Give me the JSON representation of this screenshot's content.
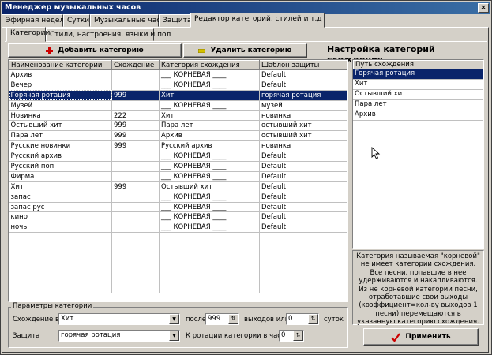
{
  "window": {
    "title": "Менеджер музыкальных часов",
    "close": "×"
  },
  "tabs": [
    {
      "label": "Эфирная неделя"
    },
    {
      "label": "Сутки"
    },
    {
      "label": "Музыкальные часы"
    },
    {
      "label": "Защита"
    },
    {
      "label": "Редактор категорий, стилей и т.д"
    }
  ],
  "subtabs": [
    {
      "label": "Категории"
    },
    {
      "label": "Стили, настроения, языки и пол"
    }
  ],
  "toolbar": {
    "add_label": "Добавить категорию",
    "delete_label": "Удалить категорию"
  },
  "heading": "Настройка категорий схождения",
  "grid": {
    "columns": [
      "Наименование категории",
      "Схождение",
      "Категория схождения",
      "Шаблон защиты"
    ],
    "rows": [
      [
        "Архив",
        "",
        "___ КОРНЕВАЯ ____",
        "Default"
      ],
      [
        "Вечер",
        "",
        "___ КОРНЕВАЯ ____",
        "Default"
      ],
      [
        "Горячая ротация",
        "999",
        "Хит",
        "горячая ротация"
      ],
      [
        "Музей",
        "",
        "___ КОРНЕВАЯ ____",
        "музей"
      ],
      [
        "Новинка",
        "222",
        "Хит",
        "новинка"
      ],
      [
        "Остывший хит",
        "999",
        "Пара лет",
        "остывший хит"
      ],
      [
        "Пара лет",
        "999",
        "Архив",
        "остывший хит"
      ],
      [
        "Русские новинки",
        "999",
        "Русский архив",
        "новинка"
      ],
      [
        "Русский архив",
        "",
        "___ КОРНЕВАЯ ____",
        "Default"
      ],
      [
        "Русский поп",
        "",
        "___ КОРНЕВАЯ ____",
        "Default"
      ],
      [
        "Фирма",
        "",
        "___ КОРНЕВАЯ ____",
        "Default"
      ],
      [
        "Хит",
        "999",
        "Остывший хит",
        "Default"
      ],
      [
        "запас",
        "",
        "___ КОРНЕВАЯ ____",
        "Default"
      ],
      [
        "запас рус",
        "",
        "___ КОРНЕВАЯ ____",
        "Default"
      ],
      [
        "кино",
        "",
        "___ КОРНЕВАЯ ____",
        "Default"
      ],
      [
        "ночь",
        "",
        "___ КОРНЕВАЯ ____",
        "Default"
      ]
    ],
    "selected_row": 2
  },
  "path": {
    "header": "Путь схождения",
    "items": [
      "Горячая ротация",
      "Хит",
      "Остывший хит",
      "Пара лет",
      "Архив"
    ],
    "selected": 0
  },
  "info_text": "Категория называемая \"корневой\" не имеет категории схождения. Все песни, попавшие в нее удерживаются и накапливаются. Из не корневой категории песни, отработавшие свои выходы (коэффициент=кол-ву выходов 1 песни) перемещаются в указанную категорию схождения.",
  "params": {
    "group_label": "Параметры категории",
    "convergence_label": "Схождение в",
    "convergence_value": "Хит",
    "after_label": "после",
    "after_value": "999",
    "outputs_label": "выходов или",
    "days_value": "0",
    "days_label": "суток",
    "protection_label": "Защита",
    "protection_value": "горячая ротация",
    "rotation_label": "К ротации категории в часах",
    "rotation_value": "0"
  },
  "apply_label": "Применить",
  "colors": {
    "selection": "#0a246a",
    "face": "#d4d0c8",
    "add_icon": "#cc0000",
    "delete_icon": "#d4c000",
    "apply_icon": "#cc0000"
  }
}
